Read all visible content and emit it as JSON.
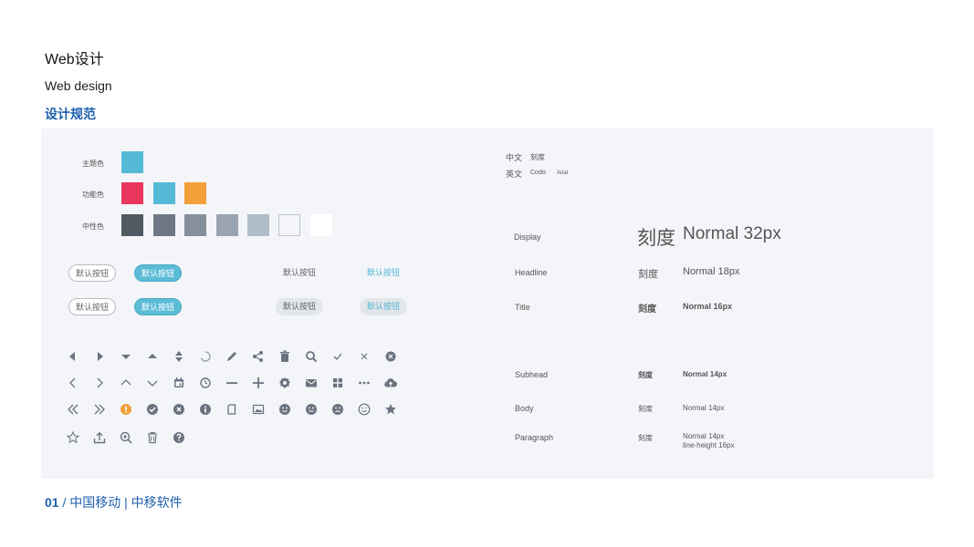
{
  "header": {
    "title": "Web设计",
    "subtitle": "Web design",
    "section": "设计规范"
  },
  "colors": {
    "theme_label": "主题色",
    "function_label": "功能色",
    "neutral_label": "中性色",
    "theme": [
      "#55bad6"
    ],
    "function": [
      "#e8365d",
      "#55bad6",
      "#f3a03a"
    ],
    "neutral": [
      "#525a64",
      "#6e7884",
      "#86909c",
      "#9aa4b0",
      "#b0bcc8",
      "#f3f5f8",
      "#ffffff"
    ]
  },
  "buttons": {
    "default_label": "默认按钮"
  },
  "fonts": {
    "cn_label": "中文",
    "cn_value": "刻度",
    "en_label": "英文",
    "en_value1": "Codo",
    "en_value2": "Arial"
  },
  "typography": [
    {
      "name": "Display",
      "sample": "刻度",
      "spec": "Normal 32px"
    },
    {
      "name": "Headline",
      "sample": "刻度",
      "spec": "Normal 18px"
    },
    {
      "name": "Title",
      "sample": "刻度",
      "spec": "Normal 16px"
    },
    {
      "name": "Subhead",
      "sample": "刻度",
      "spec": "Normal 14px"
    },
    {
      "name": "Body",
      "sample": "刻度",
      "spec": "Normal 14px"
    },
    {
      "name": "Paragraph",
      "sample": "刻度",
      "spec": "Normal 14px",
      "spec2": "line-height 16px"
    }
  ],
  "footer": {
    "number": "01",
    "separator": "/",
    "text": "中国移动 | 中移软件"
  },
  "icon_color": "#6b7380"
}
